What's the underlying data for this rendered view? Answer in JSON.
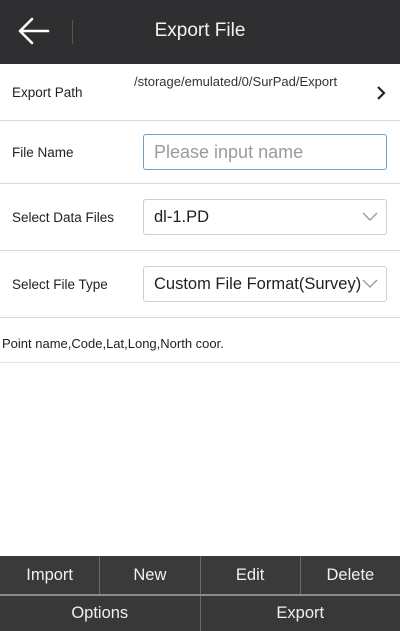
{
  "header": {
    "title": "Export File"
  },
  "export_path": {
    "label": "Export Path",
    "value": "/storage/emulated/0/SurPad/Export"
  },
  "file_name": {
    "label": "File Name",
    "placeholder": "Please input name",
    "value": ""
  },
  "data_files": {
    "label": "Select Data Files",
    "selected": "dl-1.PD"
  },
  "file_type": {
    "label": "Select File Type",
    "selected": "Custom File Format(Survey)"
  },
  "preview": {
    "text": "Point name,Code,Lat,Long,North coor."
  },
  "toolbar": {
    "import_label": "Import",
    "new_label": "New",
    "edit_label": "Edit",
    "delete_label": "Delete",
    "options_label": "Options",
    "export_label": "Export"
  },
  "colors": {
    "header_bg": "#2f2f31",
    "toolbar_bg": "#3a3a3a",
    "input_border": "#6f9fbf"
  },
  "icons": {
    "back": "arrow-left-icon",
    "path_chevron": "chevron-right-icon",
    "dropdown": "chevron-down-icon"
  }
}
